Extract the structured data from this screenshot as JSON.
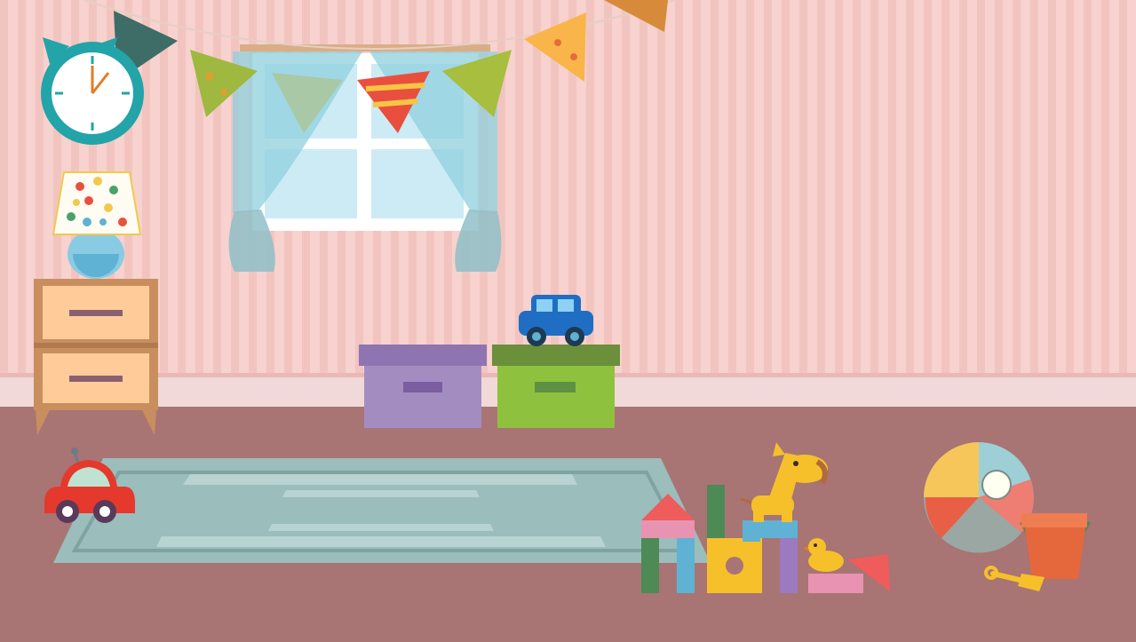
{
  "scene": {
    "kind": "illustration",
    "subject": "kids-playroom",
    "elements": [
      "striped-wall",
      "bunting-garland",
      "wall-clock",
      "window-with-curtains",
      "table-lamp",
      "nightstand-drawers",
      "storage-box-purple",
      "storage-box-green",
      "toy-car-blue",
      "toy-car-red",
      "floor-rug",
      "building-blocks",
      "toy-giraffe",
      "rubber-duck",
      "beach-ball",
      "sand-bucket",
      "toy-shovel"
    ]
  },
  "colors": {
    "wall": "#F7D2CE",
    "wall_stripe": "#F1C1BD",
    "baseboard": "#F1D9D9",
    "floor": "#A87474",
    "rug": "#9BBDBC",
    "clock_ring": "#22A4A8",
    "curtain": "#8FD0DD",
    "nightstand": "#C98E5E",
    "drawer_face": "#FFCC99",
    "box_purple": "#A38DC0",
    "box_green": "#8EC23E",
    "car_blue": "#1F6EC3",
    "car_red": "#E5392D",
    "giraffe": "#F6C02B",
    "bucket": "#E5683C"
  }
}
